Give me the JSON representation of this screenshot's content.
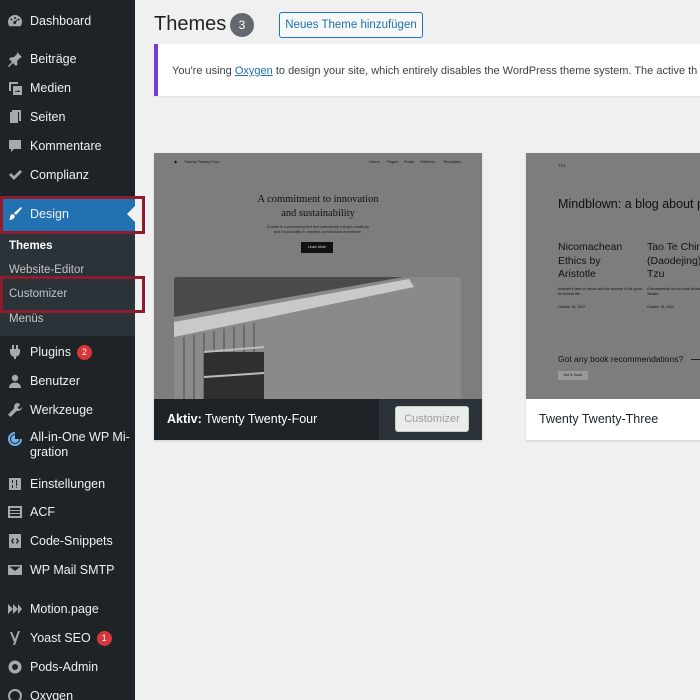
{
  "sidebar": {
    "items": [
      {
        "label": "Dashboard",
        "icon": "dashboard-icon"
      },
      {
        "label": "Beiträge",
        "icon": "pin-icon"
      },
      {
        "label": "Medien",
        "icon": "media-icon"
      },
      {
        "label": "Seiten",
        "icon": "pages-icon"
      },
      {
        "label": "Kommentare",
        "icon": "comments-icon"
      },
      {
        "label": "Complianz",
        "icon": "check-icon"
      },
      {
        "label": "Design",
        "icon": "brush-icon"
      },
      {
        "label": "Plugins",
        "icon": "plugin-icon",
        "badge": "2"
      },
      {
        "label": "Benutzer",
        "icon": "user-icon"
      },
      {
        "label": "Werkzeuge",
        "icon": "wrench-icon"
      },
      {
        "label": "All-in-One WP Mi-gration",
        "icon": "migration-icon"
      },
      {
        "label": "Einstellungen",
        "icon": "settings-icon"
      },
      {
        "label": "ACF",
        "icon": "acf-icon"
      },
      {
        "label": "Code-Snippets",
        "icon": "code-icon"
      },
      {
        "label": "WP Mail SMTP",
        "icon": "mail-icon"
      },
      {
        "label": "Motion.page",
        "icon": "motion-icon"
      },
      {
        "label": "Yoast SEO",
        "icon": "yoast-icon",
        "badge": "1"
      },
      {
        "label": "Pods-Admin",
        "icon": "pods-icon"
      },
      {
        "label": "Oxygen",
        "icon": "oxygen-icon"
      }
    ],
    "submenu": [
      {
        "label": "Themes"
      },
      {
        "label": "Website-Editor"
      },
      {
        "label": "Customizer"
      },
      {
        "label": "Menüs"
      }
    ]
  },
  "header": {
    "title": "Themes",
    "count": "3",
    "add_button": "Neues Theme hinzufügen"
  },
  "notice": {
    "before": "You're using ",
    "link": "Oxygen",
    "after": " to design your site, which entirely disables the WordPress theme system. The active th"
  },
  "themes": {
    "active": {
      "prefix": "Aktiv:",
      "name": "Twenty Twenty-Four",
      "customize_button": "Customizer",
      "preview": {
        "site_title": "Twenty Twenty Four",
        "nav": [
          "Home",
          "Pages",
          "Posts",
          "Patterns",
          "Templates"
        ],
        "heading_line1": "A commitment to innovation",
        "heading_line2": "and sustainability",
        "subtext_line1": "Études is a pioneering firm that seamlessly merges creativity",
        "subtext_line2": "and functionality to redefine architectural excellence.",
        "button": "Learn More"
      }
    },
    "second": {
      "name": "Twenty Twenty-Three",
      "preview": {
        "site_title": "TT3",
        "heading": "Mindblown: a blog about p",
        "post1_title": "Nicomachean Ethics by Aristotle",
        "post1_excerpt": "Aristotle's take on ethics and the science of the good for human life.",
        "post1_date": "October 18, 2022",
        "post2_title": "Tao Te Chin (Daodejing) Lao Tzu",
        "post2_excerpt": "A fundamental text for both philosophical religious Taoism.",
        "post2_date": "October 18, 2022",
        "cta": "Got any book recommendations?",
        "cta_button": "Get In Touch"
      }
    }
  },
  "colors": {
    "sidebar_bg": "#1d2327",
    "active_blue": "#2271b1",
    "highlight_red": "#8b1d2c",
    "notice_accent": "#7e3bd0",
    "badge_red": "#d63638"
  }
}
